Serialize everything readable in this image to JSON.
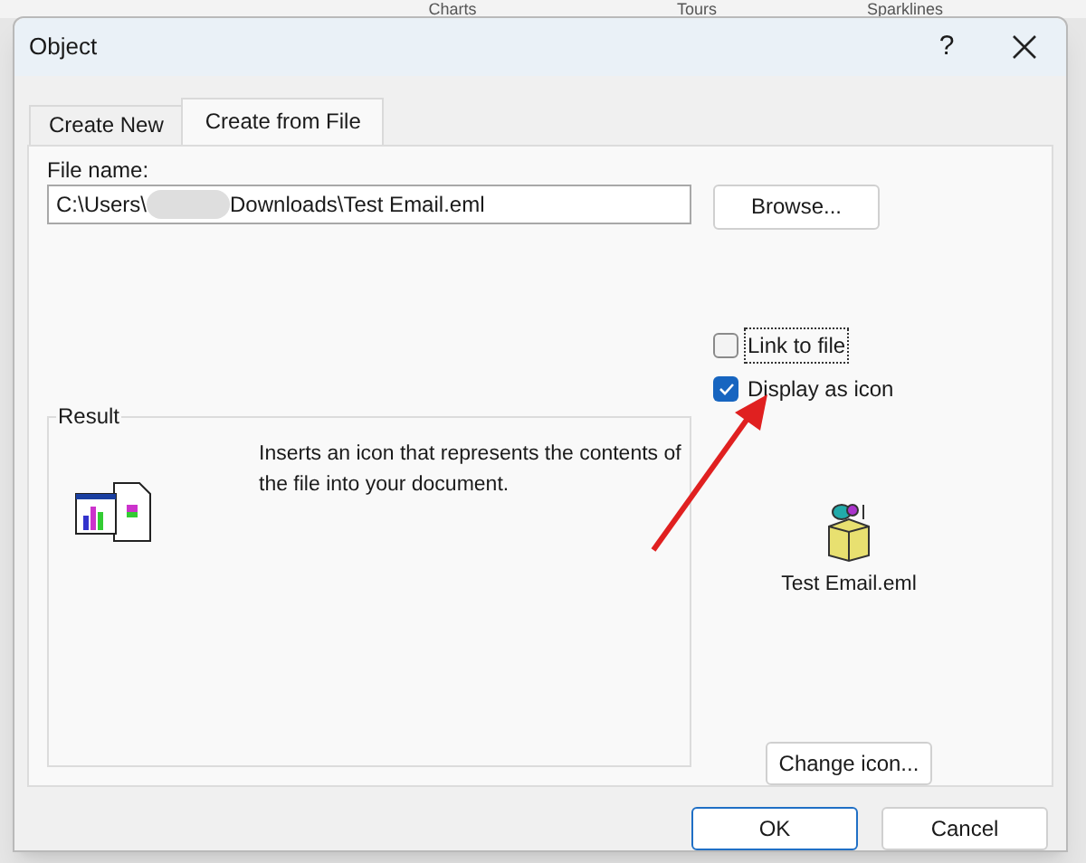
{
  "background_ribbon": {
    "groups": [
      "Charts",
      "Tours",
      "Sparklines"
    ]
  },
  "window": {
    "title": "Object",
    "help": "?"
  },
  "tabs": [
    {
      "label": "Create New",
      "selected": false
    },
    {
      "label": "Create from File",
      "selected": true
    }
  ],
  "file_name": {
    "label": "File name:",
    "value_start": "C:\\Users\\",
    "value_end": "Downloads\\Test Email.eml",
    "redacted": true
  },
  "browse_button": "Browse...",
  "options": [
    {
      "label": "Link to file",
      "checked": false,
      "focused": true
    },
    {
      "label": "Display as icon",
      "checked": true,
      "focused": false
    }
  ],
  "result": {
    "title": "Result",
    "text": "Inserts an icon that represents the contents of the file into your document."
  },
  "icon_preview": {
    "caption": "Test Email.eml"
  },
  "change_icon_button": "Change icon...",
  "buttons": [
    {
      "label": "OK",
      "default": true
    },
    {
      "label": "Cancel",
      "default": false
    }
  ]
}
